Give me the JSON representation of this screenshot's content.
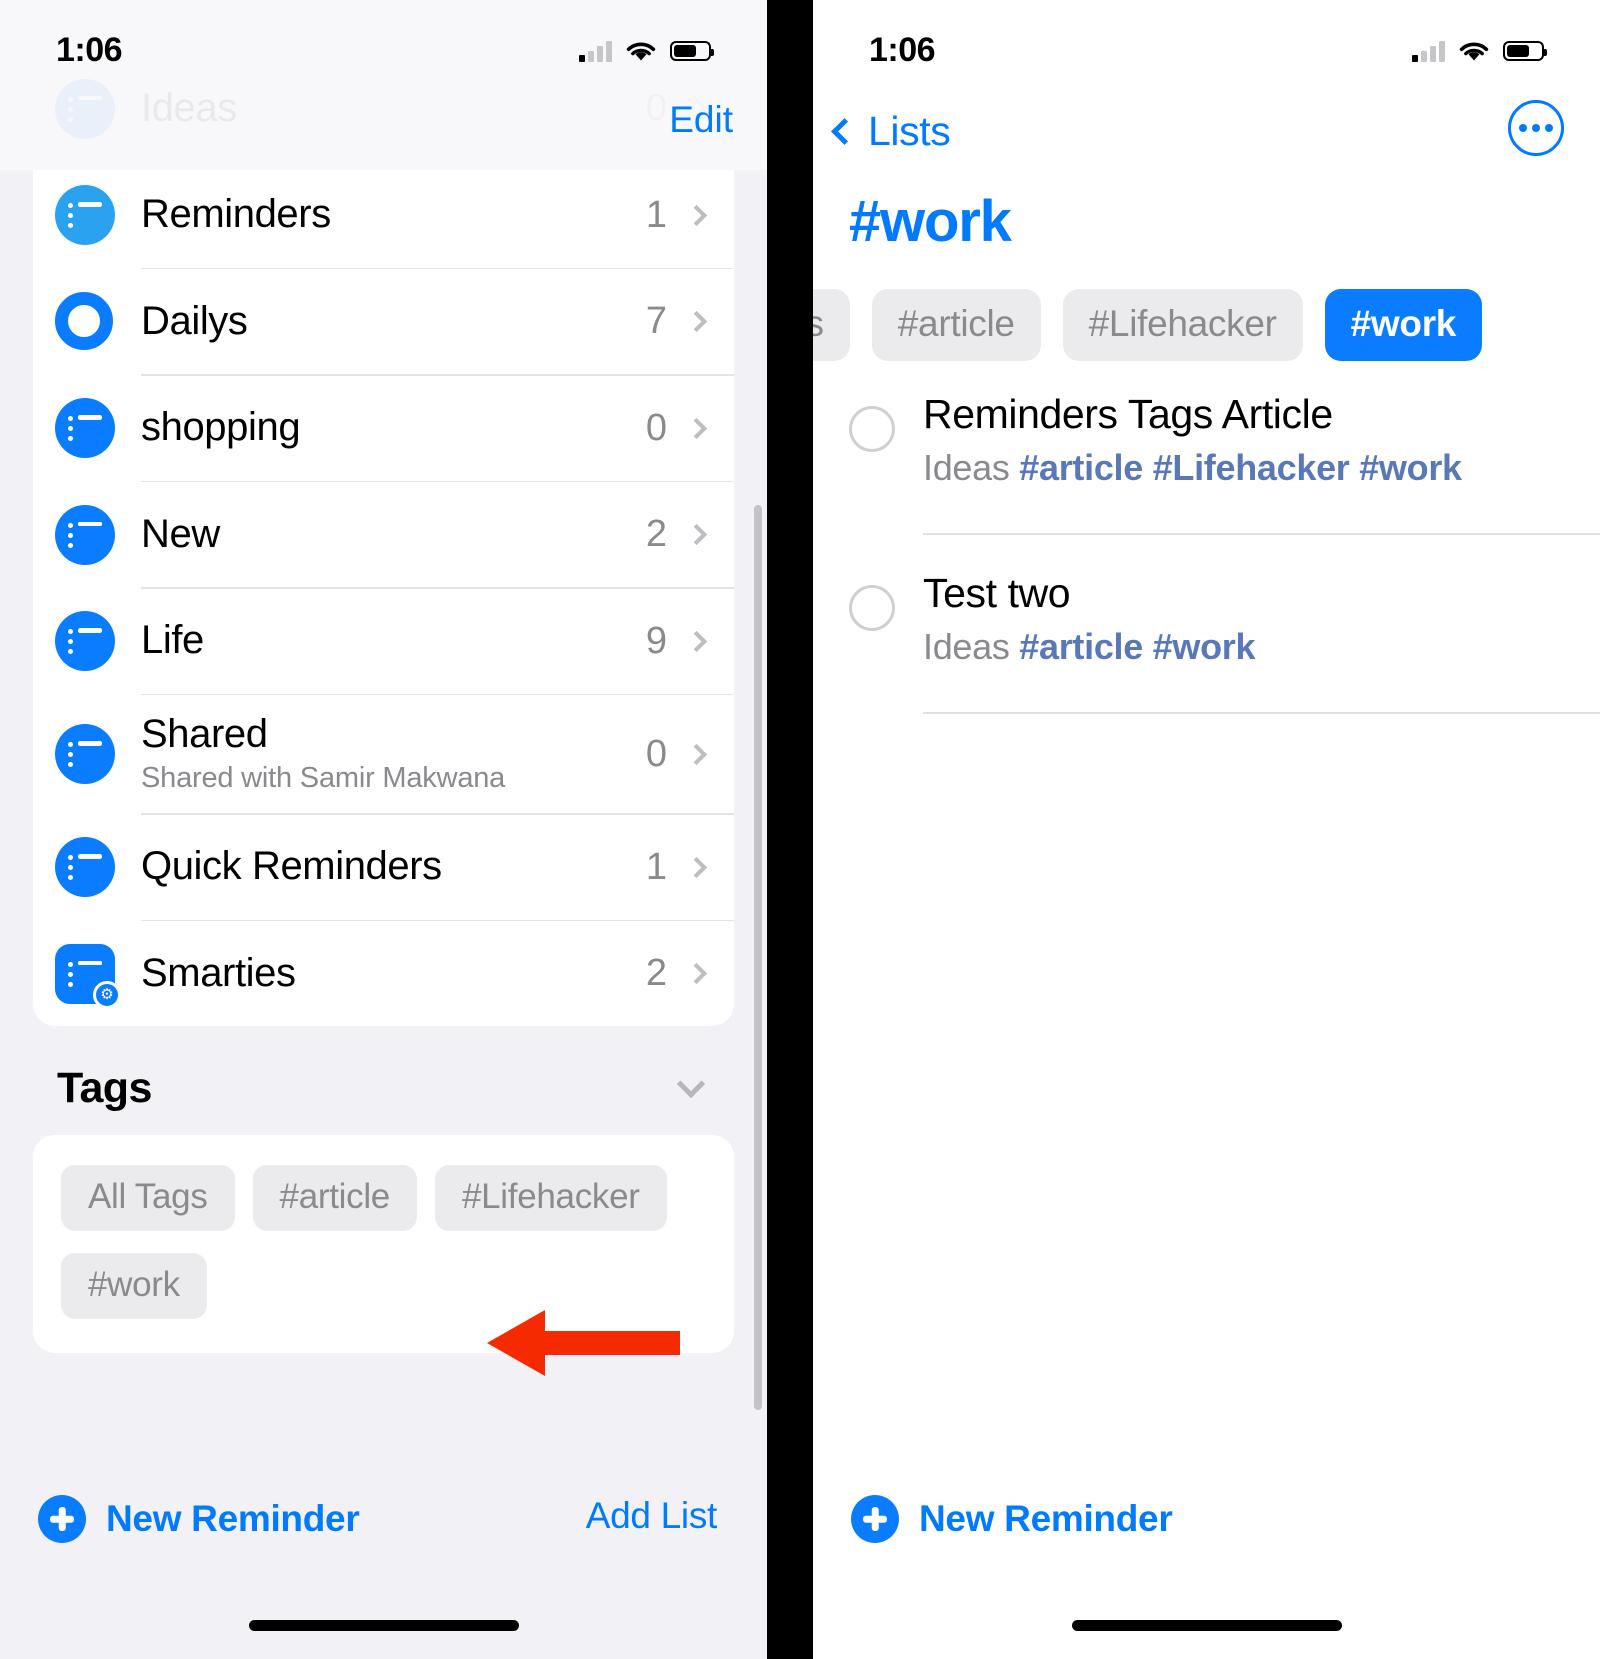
{
  "left": {
    "status": {
      "time": "1:06"
    },
    "nav": {
      "edit_label": "Edit"
    },
    "lists": [
      {
        "name": "Ideas",
        "count": "0",
        "sub": "",
        "icon": "list-icon",
        "shape": "circle",
        "tone": "blue",
        "partial": true
      },
      {
        "name": "Reminders",
        "count": "1",
        "sub": "",
        "icon": "list-icon",
        "shape": "circle",
        "tone": "light"
      },
      {
        "name": "Dailys",
        "count": "7",
        "sub": "",
        "icon": "ring-icon",
        "shape": "ring",
        "tone": "blue"
      },
      {
        "name": "shopping",
        "count": "0",
        "sub": "",
        "icon": "list-icon",
        "shape": "circle",
        "tone": "blue"
      },
      {
        "name": "New",
        "count": "2",
        "sub": "",
        "icon": "list-icon",
        "shape": "circle",
        "tone": "blue"
      },
      {
        "name": "Life",
        "count": "9",
        "sub": "",
        "icon": "list-icon",
        "shape": "circle",
        "tone": "blue"
      },
      {
        "name": "Shared",
        "count": "0",
        "sub": "Shared with Samir Makwana",
        "icon": "list-icon",
        "shape": "circle",
        "tone": "blue"
      },
      {
        "name": "Quick Reminders",
        "count": "1",
        "sub": "",
        "icon": "list-icon",
        "shape": "circle",
        "tone": "blue"
      },
      {
        "name": "Smarties",
        "count": "2",
        "sub": "",
        "icon": "smart-list-icon",
        "shape": "square",
        "tone": "blue"
      }
    ],
    "tags_section": {
      "header": "Tags",
      "collapse_icon": "chevron-down-icon",
      "pills": [
        {
          "label": "All Tags",
          "selected": false
        },
        {
          "label": "#article",
          "selected": false
        },
        {
          "label": "#Lifehacker",
          "selected": false
        },
        {
          "label": "#work",
          "selected": false
        }
      ]
    },
    "toolbar": {
      "new_reminder": "New Reminder",
      "add_list": "Add List",
      "plus_icon": "plus-circle-icon"
    },
    "annotation": {
      "arrow_icon": "red-arrow-left",
      "color": "#f62a00"
    }
  },
  "right": {
    "status": {
      "time": "1:06"
    },
    "nav": {
      "back_label": "Lists",
      "back_icon": "chevron-left-icon",
      "more_icon": "ellipsis-circle-icon"
    },
    "title": "#work",
    "tag_filters": [
      {
        "label": "ags",
        "selected": false
      },
      {
        "label": "#article",
        "selected": false
      },
      {
        "label": "#Lifehacker",
        "selected": false
      },
      {
        "label": "#work",
        "selected": true
      }
    ],
    "reminders": [
      {
        "title": "Reminders Tags Article",
        "list": "Ideas",
        "tags": [
          "#article",
          "#Lifehacker",
          "#work"
        ],
        "checkbox_icon": "circle-unchecked-icon"
      },
      {
        "title": "Test two",
        "list": "Ideas",
        "tags": [
          "#article",
          "#work"
        ],
        "checkbox_icon": "circle-unchecked-icon"
      }
    ],
    "toolbar": {
      "new_reminder": "New Reminder",
      "plus_icon": "plus-circle-icon"
    }
  },
  "colors": {
    "accent": "#007aff",
    "icon_blue": "#0a7cff",
    "icon_light_blue": "#2ba2f0",
    "tag_text": "#5878b8",
    "arrow_red": "#f62a00",
    "bg_gray": "#f2f1f6",
    "pill_gray": "#ebebed"
  }
}
